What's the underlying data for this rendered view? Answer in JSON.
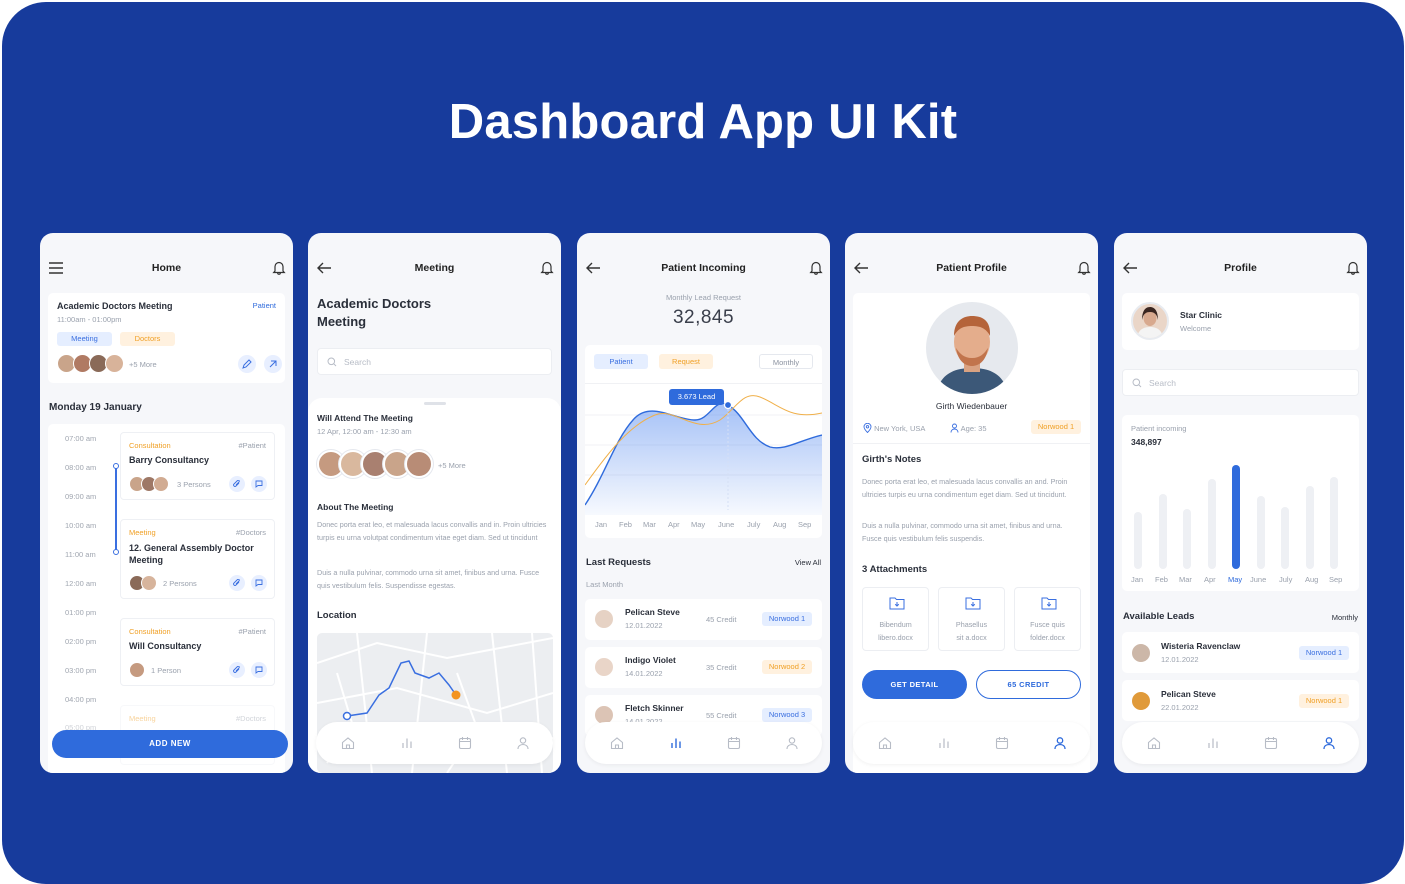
{
  "title": "Dashboard App UI Kit",
  "colors": {
    "background": "#173b9c",
    "accent": "#2f6bdc",
    "orange": "#f0a026"
  },
  "phone1": {
    "header": {
      "title": "Home",
      "menu_icon": "menu-icon",
      "bell_icon": "bell-icon"
    },
    "meeting_card": {
      "title": "Academic Doctors Meeting",
      "tag": "Patient",
      "time": "11:00am - 01:00pm",
      "badge1": "Meeting",
      "badge2": "Doctors",
      "more": "+5 More"
    },
    "date": "Monday 19 January",
    "times": [
      "07:00 am",
      "08:00 am",
      "09:00 am",
      "10:00 am",
      "11:00 am",
      "12:00 am",
      "01:00 pm",
      "02:00 pm",
      "03:00 pm",
      "04:00 pm",
      "05:00 pm"
    ],
    "events": [
      {
        "type": "Consultation",
        "tag": "#Patient",
        "title": "Barry Consultancy",
        "persons": "3 Persons"
      },
      {
        "type": "Meeting",
        "tag": "#Doctors",
        "title": "12. General Assembly Doctor Meeting",
        "persons": "2 Persons"
      },
      {
        "type": "Consultation",
        "tag": "#Patient",
        "title": "Will Consultancy",
        "persons": "1 Person"
      },
      {
        "type": "Meeting",
        "tag": "#Doctors"
      }
    ],
    "add_button": "ADD NEW"
  },
  "phone2": {
    "header": {
      "title": "Meeting"
    },
    "heading": [
      "Academic Doctors",
      "Meeting"
    ],
    "search_placeholder": "Search",
    "attend_title": "Will Attend The Meeting",
    "attend_time": "12 Apr, 12:00 am - 12:30 am",
    "more": "+5 More",
    "about_title": "About The Meeting",
    "about_p1": "Donec porta erat leo, et malesuada lacus convallis and in. Proin ultricies turpis eu urna volutpat condimentum vitae eget diam. Sed ut tincidunt",
    "about_p2": "Duis a nulla pulvinar, commodo urna sit amet, finibus and urna. Fusce quis vestibulum felis. Suspendisse egestas.",
    "location_title": "Location"
  },
  "phone3": {
    "header": {
      "title": "Patient Incoming"
    },
    "lead_label": "Monthly Lead Request",
    "lead_value": "32,845",
    "tabs": {
      "patient": "Patient",
      "request": "Request",
      "period": "Monthly"
    },
    "tooltip": "3.673 Lead",
    "months": [
      "Jan",
      "Feb",
      "Mar",
      "Apr",
      "May",
      "June",
      "July",
      "Aug",
      "Sep"
    ],
    "last_requests": "Last Requests",
    "view_all": "View All",
    "last_month": "Last Month",
    "requests": [
      {
        "name": "Pelican Steve",
        "date": "12.01.2022",
        "credit": "45 Credit",
        "tag": "Norwood 1",
        "tag_color": "blue"
      },
      {
        "name": "Indigo Violet",
        "date": "14.01.2022",
        "credit": "35 Credit",
        "tag": "Norwood 2",
        "tag_color": "orange"
      },
      {
        "name": "Fletch Skinner",
        "date": "14.01.2022",
        "credit": "55 Credit",
        "tag": "Norwood 3",
        "tag_color": "blue"
      }
    ]
  },
  "phone4": {
    "header": {
      "title": "Patient Profile"
    },
    "name": "Girth Wiedenbauer",
    "location": "New York, USA",
    "age": "Age: 35",
    "tag": "Norwood 1",
    "notes_title": "Girth's Notes",
    "notes_p1": "Donec porta erat leo, et malesuada lacus convallis an and. Proin ultricies turpis eu urna condimentum eget diam. Sed ut tincidunt.",
    "notes_p2": "Duis a nulla pulvinar, commodo urna sit amet, finibus and urna. Fusce quis vestibulum felis suspendis.",
    "attachments_title": "3 Attachments",
    "attachments": [
      {
        "line1": "Bibendum",
        "line2": "libero.docx"
      },
      {
        "line1": "Phasellus",
        "line2": "sit a.docx"
      },
      {
        "line1": "Fusce quis",
        "line2": "folder.docx"
      }
    ],
    "get_detail": "GET DETAIL",
    "credit": "65 CREDIT"
  },
  "phone5": {
    "header": {
      "title": "Profile"
    },
    "clinic": "Star Clinic",
    "welcome": "Welcome",
    "search_placeholder": "Search",
    "incoming_label": "Patient incoming",
    "incoming_value": "348,897",
    "months": [
      "Jan",
      "Feb",
      "Mar",
      "Apr",
      "May",
      "June",
      "July",
      "Aug",
      "Sep"
    ],
    "bars": [
      0.55,
      0.72,
      0.58,
      0.87,
      1.0,
      0.7,
      0.6,
      0.8,
      0.88
    ],
    "available_leads": "Available Leads",
    "period": "Monthly",
    "leads": [
      {
        "name": "Wisteria Ravenclaw",
        "date": "12.01.2022",
        "tag": "Norwood 1",
        "tag_color": "blue"
      },
      {
        "name": "Pelican Steve",
        "date": "22.01.2022",
        "tag": "Norwood 1",
        "tag_color": "orange"
      }
    ]
  }
}
